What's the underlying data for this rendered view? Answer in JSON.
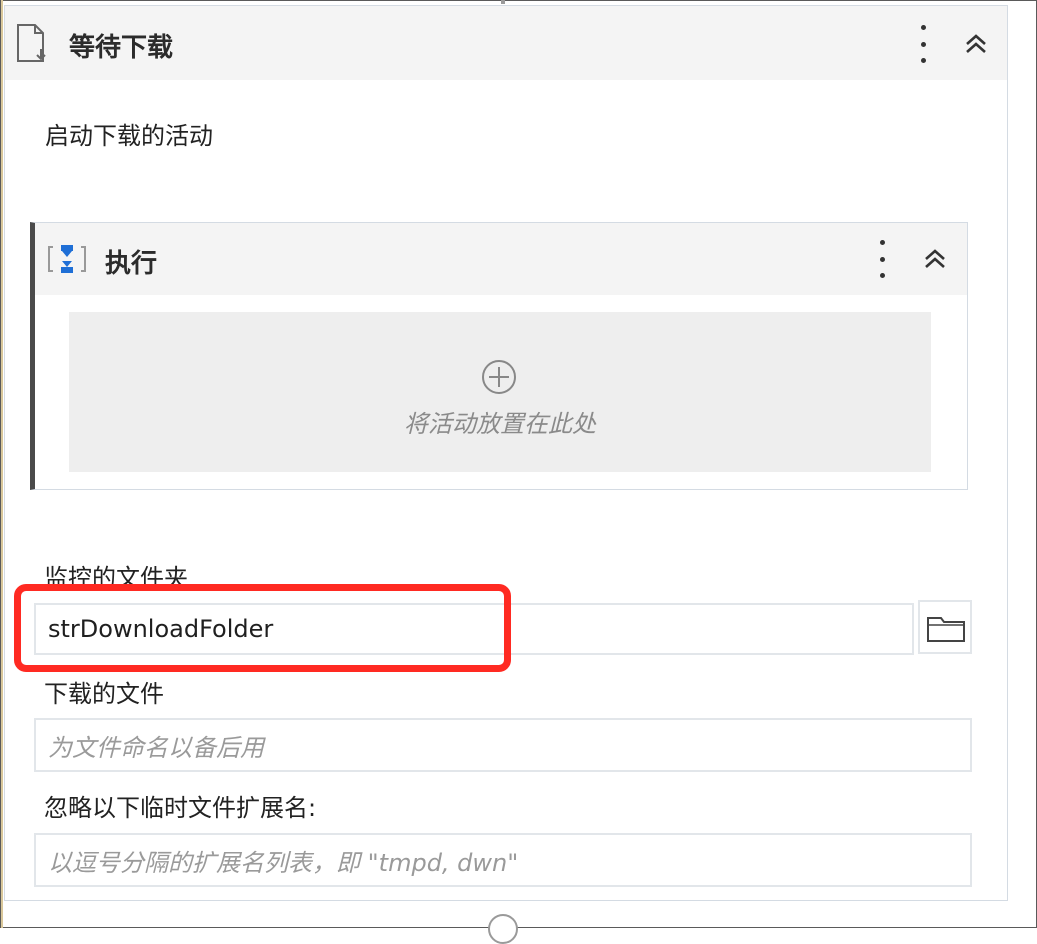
{
  "activity": {
    "title": "等待下载",
    "icon": "wait-download-icon",
    "section_label": "启动下载的活动"
  },
  "sequence": {
    "title": "执行",
    "icon": "sequence-icon",
    "drop_hint": "将活动放置在此处",
    "add_icon": "plus-circle-icon"
  },
  "fields": {
    "monitored_folder_label": "监控的文件夹",
    "monitored_folder_value": "strDownloadFolder",
    "downloaded_file_label": "下载的文件",
    "downloaded_file_placeholder": "为文件命名以备后用",
    "ignore_ext_label": "忽略以下临时文件扩展名:",
    "ignore_ext_placeholder": "以逗号分隔的扩展名列表，即 \"tmpd, dwn\""
  },
  "colors": {
    "highlight": "#ff2a22",
    "header_bg": "#f4f4f4",
    "seq_icon_blue": "#1f6fd6"
  }
}
